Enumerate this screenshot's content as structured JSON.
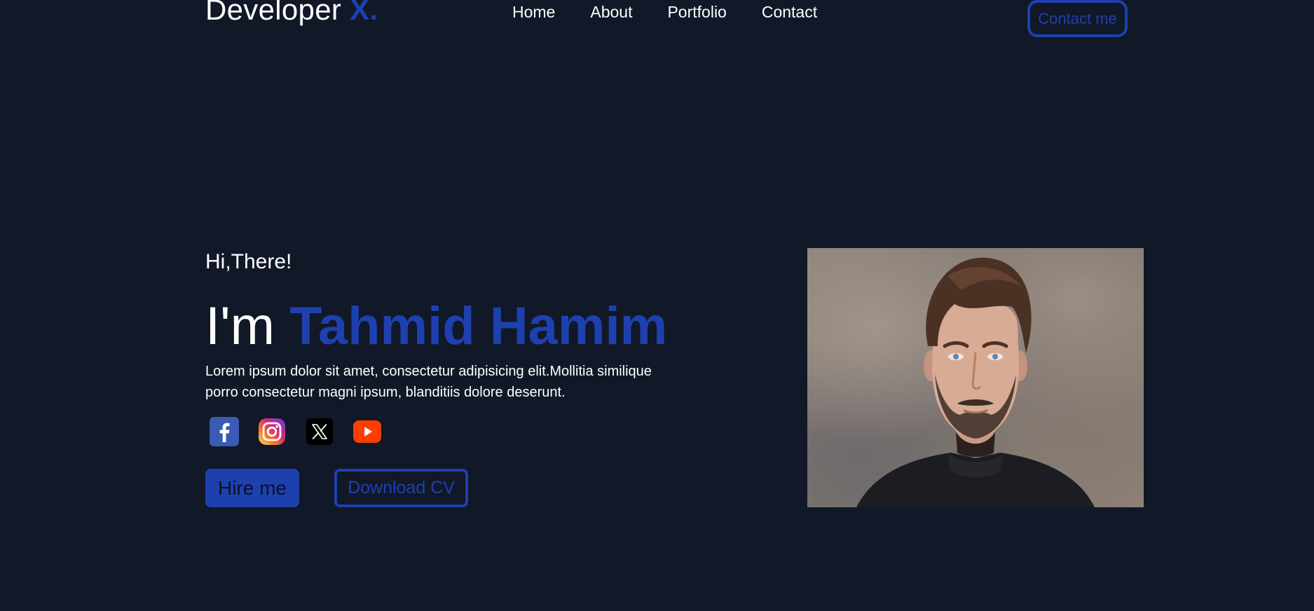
{
  "brand": {
    "name": "Developer ",
    "accent": "X."
  },
  "nav": {
    "items": [
      "Home",
      "About",
      "Portfolio",
      "Contact"
    ]
  },
  "header": {
    "contact_label": "Contact me"
  },
  "hero": {
    "greeting": "Hi,There!",
    "prefix": "I'm ",
    "name": "Tahmid Hamim",
    "description": "Lorem ipsum dolor sit amet, consectetur adipisicing elit.Mollitia similique porro consectetur magni ipsum, blanditiis dolore deserunt.",
    "hire_label": "Hire me",
    "cv_label": "Download CV"
  },
  "socials": [
    {
      "icon": "facebook-icon"
    },
    {
      "icon": "instagram-icon"
    },
    {
      "icon": "x-twitter-icon"
    },
    {
      "icon": "youtube-icon"
    }
  ],
  "colors": {
    "background": "#111827",
    "accent": "#1e40af",
    "text": "#ffffff"
  }
}
